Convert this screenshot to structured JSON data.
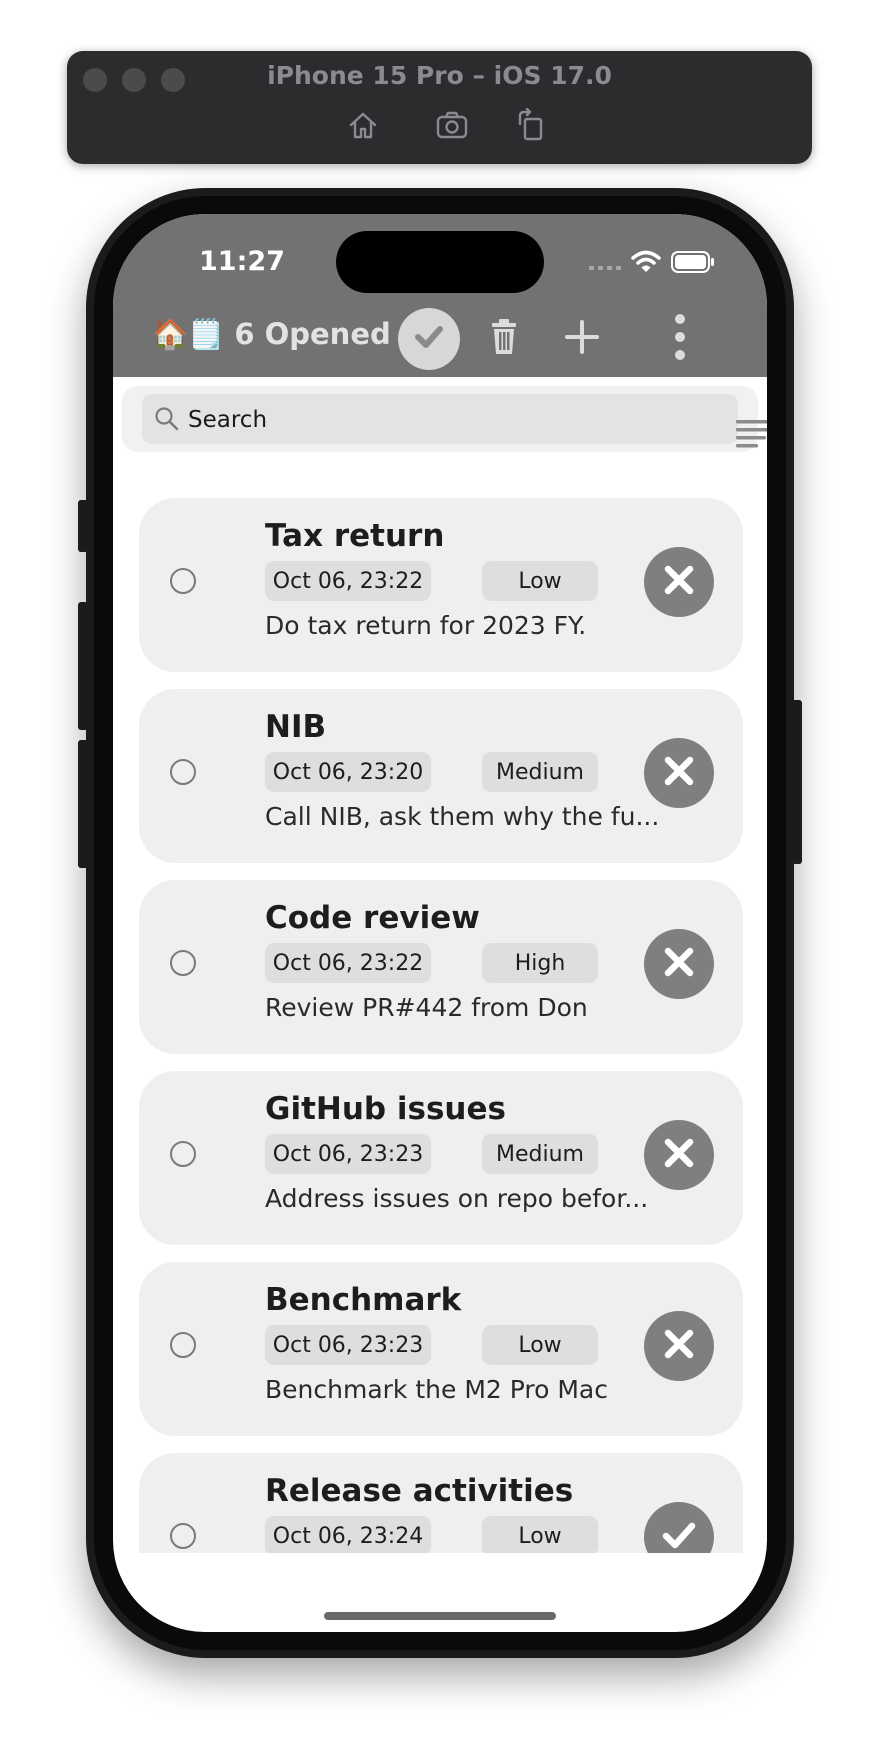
{
  "simulator": {
    "title": "iPhone 15 Pro – iOS 17.0",
    "buttons": [
      "home-icon",
      "screenshot-icon",
      "rotate-icon"
    ]
  },
  "status_bar": {
    "time": "11:27",
    "icons": [
      "cellular-icon",
      "wifi-icon",
      "battery-icon"
    ]
  },
  "navbar": {
    "emoji": "🏠🗒️",
    "title": "6 Opened",
    "actions": [
      "checkmark-icon",
      "trash-icon",
      "plus-icon",
      "more-icon"
    ]
  },
  "search": {
    "placeholder": "Search"
  },
  "tasks": [
    {
      "title": "Tax return",
      "date": "Oct 06, 23:22",
      "priority": "Low",
      "description": "Do tax return for 2023 FY.",
      "action": "delete"
    },
    {
      "title": "NIB",
      "date": "Oct 06, 23:20",
      "priority": "Medium",
      "description": "Call NIB, ask them why the fu...",
      "action": "delete"
    },
    {
      "title": "Code review",
      "date": "Oct 06, 23:22",
      "priority": "High",
      "description": "Review PR#442 from Don",
      "action": "delete"
    },
    {
      "title": "GitHub issues",
      "date": "Oct 06, 23:23",
      "priority": "Medium",
      "description": "Address issues on repo befor...",
      "action": "delete"
    },
    {
      "title": "Benchmark",
      "date": "Oct 06, 23:23",
      "priority": "Low",
      "description": "Benchmark the M2 Pro Mac",
      "action": "delete"
    },
    {
      "title": "Release activities",
      "date": "Oct 06, 23:24",
      "priority": "Low",
      "description": "",
      "action": "complete"
    }
  ],
  "colors": {
    "navbar": "#727272",
    "card": "#efefef",
    "chip": "#dedede",
    "action_button": "#7f7f7f"
  }
}
